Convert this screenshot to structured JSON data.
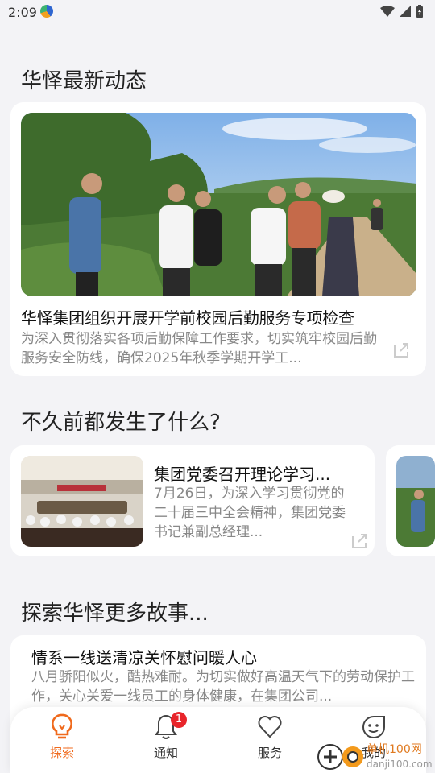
{
  "status_bar": {
    "time": "2:09"
  },
  "sections": {
    "latest_title": "华怿最新动态",
    "recent_title": "不久前都发生了什么?",
    "explore_title": "探索华怿更多故事..."
  },
  "hero": {
    "title": "华怿集团组织开展开学前校园后勤服务专项检查",
    "summary": "为深入贯彻落实各项后勤保障工作要求，切实筑牢校园后勤服务安全防线，确保2025年秋季学期开学工..."
  },
  "recent_cards": [
    {
      "title": "集团党委召开理论学习...",
      "summary": "7月26日，为深入学习贯彻党的二十届三中全会精神，集团党委书记兼副总经理..."
    }
  ],
  "story": {
    "title": "情系一线送清凉关怀慰问暖人心",
    "summary": "八月骄阳似火，酷热难耐。为切实做好高温天气下的劳动保护工作，关心关爱一线员工的身体健康，在集团公司..."
  },
  "nav": {
    "items": [
      {
        "label": "探索",
        "icon": "lightbulb-icon",
        "active": true
      },
      {
        "label": "通知",
        "icon": "bell-icon",
        "badge": "1"
      },
      {
        "label": "服务",
        "icon": "heart-icon"
      },
      {
        "label": "我的",
        "icon": "smile-icon"
      }
    ]
  },
  "watermark": {
    "text": "单机100网",
    "url": "danji100.com"
  },
  "colors": {
    "accent": "#f06a1d",
    "badge": "#e8252b",
    "background": "#f3f3f6"
  }
}
